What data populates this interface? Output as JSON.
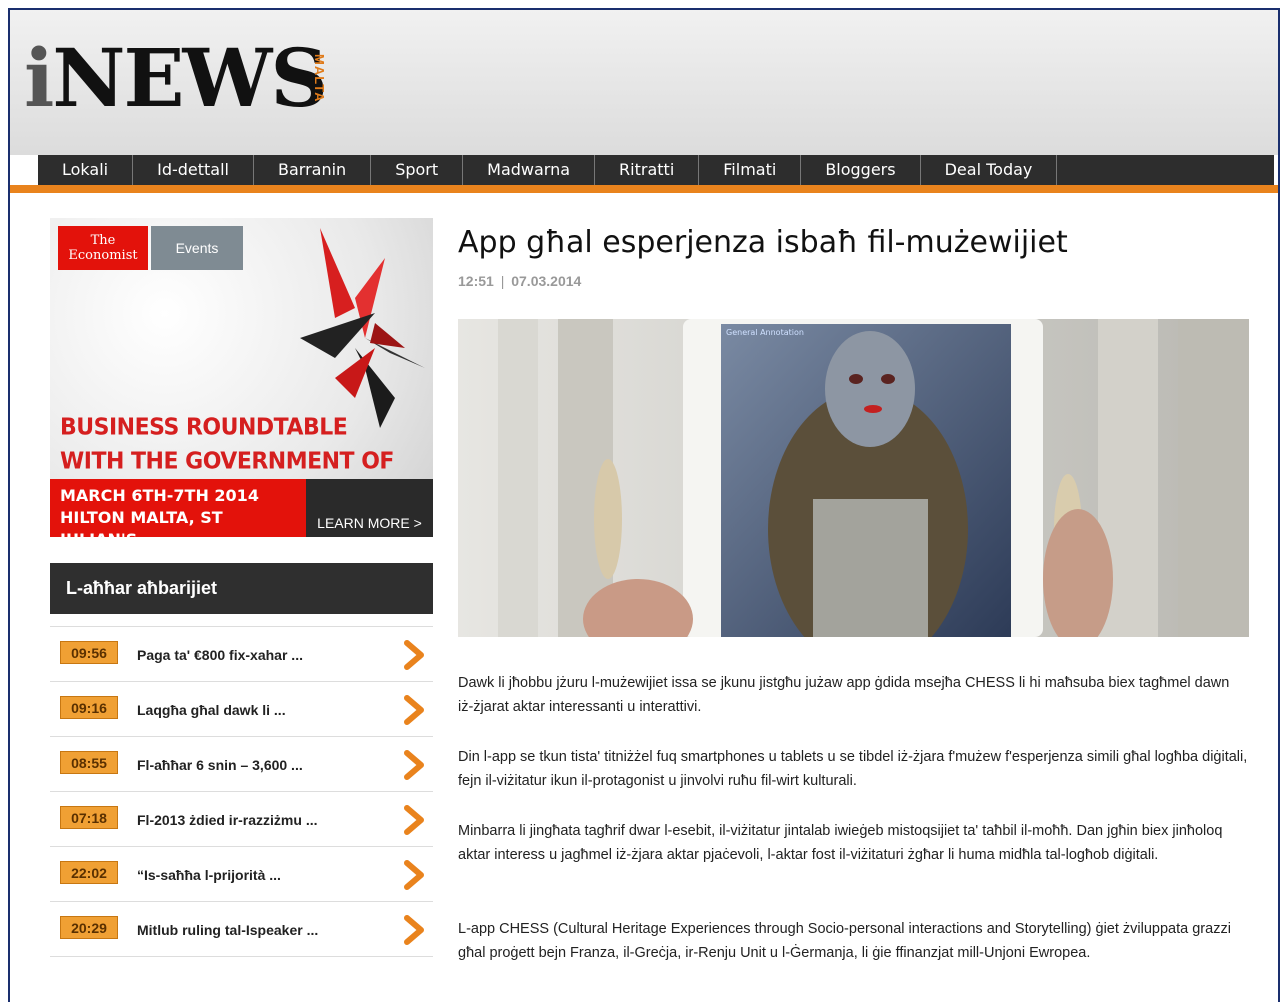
{
  "logo": {
    "i": "i",
    "rest": "NEWS",
    "sub": "MALTA"
  },
  "nav": {
    "items": [
      "Lokali",
      "Id-dettall",
      "Barranin",
      "Sport",
      "Madwarna",
      "Ritratti",
      "Filmati",
      "Bloggers",
      "Deal Today"
    ]
  },
  "ad": {
    "brand_line1": "The",
    "brand_line2": "Economist",
    "events": "Events",
    "title_line1": "BUSINESS ROUNDTABLE",
    "title_line2": "WITH THE GOVERNMENT OF MALTA",
    "date_line": "MARCH 6TH-7TH 2014",
    "venue_line": "HILTON MALTA, ST JULIAN'S",
    "cta": "LEARN MORE >"
  },
  "latest": {
    "heading": "L-aħħar aħbarijiet",
    "items": [
      {
        "time": "09:56",
        "text": "Paga ta' €800 fix-xahar ..."
      },
      {
        "time": "09:16",
        "text": "Laqgħa għal dawk li ..."
      },
      {
        "time": "08:55",
        "text": "Fl-aħħar 6 snin – 3,600 ..."
      },
      {
        "time": "07:18",
        "text": "Fl-2013 żdied ir-razziżmu ..."
      },
      {
        "time": "22:02",
        "text": "“Is-saħħa l-prijorità ..."
      },
      {
        "time": "20:29",
        "text": "Mitlub ruling tal-Ispeaker ..."
      }
    ]
  },
  "article": {
    "title": "App għal esperjenza isbaħ fil-mużewijiet",
    "time": "12:51",
    "separator": "|",
    "date": "07.03.2014",
    "photo_overlay": "General Annotation",
    "paragraphs": [
      "Dawk li jħobbu jżuru l-mużewijiet issa se jkunu jistgħu jużaw app ġdida msejħa CHESS li hi maħsuba biex tagħmel dawn iż-żjarat aktar interessanti u interattivi.",
      "Din l-app se tkun tista' titniżżel fuq smartphones u tablets u se tibdel iż-żjara f'mużew f'esperjenza simili għal logħba diġitali, fejn il-viżitatur ikun il-protagonist u jinvolvi ruħu fil-wirt kulturali.",
      "Minbarra li jingħata tagħrif dwar l-esebit, il-viżitatur jintalab iwieġeb mistoqsijiet ta' taħbil il-moħħ. Dan jgħin biex jinħoloq aktar interess u jagħmel iż-żjara aktar pjaċevoli, l-aktar fost il-viżitaturi żgħar li huma midħla tal-logħob diġitali.",
      "L-app CHESS (Cultural Heritage Experiences through Socio-personal interactions and Storytelling) ġiet żviluppata grazzi għal proġett bejn Franza, il-Greċja, ir-Renju Unit u l-Ġermanja, li ġie ffinanzjat mill-Unjoni Ewropea."
    ]
  },
  "colors": {
    "accent": "#e9831d",
    "nav_bg": "#2d2d2d",
    "frame": "#1a2f6e",
    "badge": "#f0a034"
  }
}
